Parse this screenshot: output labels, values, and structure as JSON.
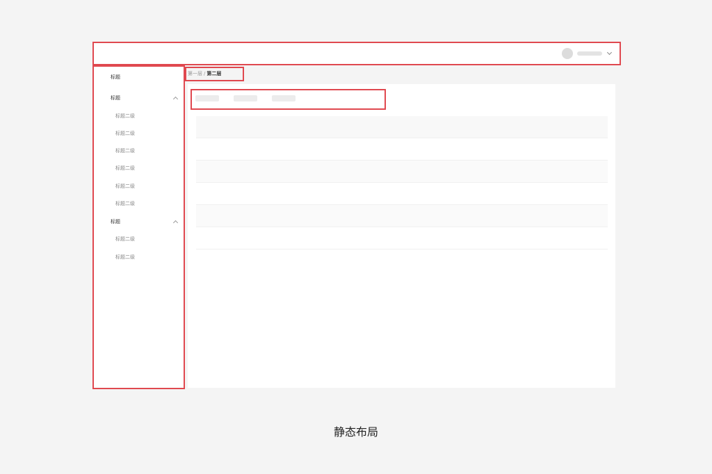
{
  "sidebar": {
    "title": "标题",
    "groups": [
      {
        "label": "标题",
        "items": [
          "标题二级",
          "标题二级",
          "标题二级",
          "标题二级",
          "标题二级",
          "标题二级"
        ]
      },
      {
        "label": "标题",
        "items": [
          "标题二级",
          "标题二级"
        ]
      }
    ]
  },
  "breadcrumb": {
    "level1": "第一层",
    "separator": "/",
    "level2": "第二层"
  },
  "caption": "静态布局",
  "colors": {
    "outline": "#e0484f",
    "background": "#f4f4f4",
    "panel": "#ffffff"
  }
}
